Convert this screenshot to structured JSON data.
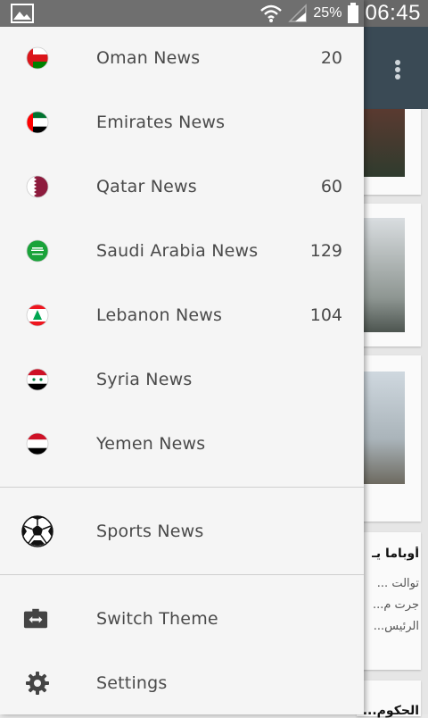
{
  "status_bar": {
    "battery_percent": "25%",
    "time": "06:45",
    "icons": [
      "image-icon",
      "wifi-icon",
      "signal-icon",
      "battery-icon"
    ]
  },
  "drawer": {
    "countries": [
      {
        "label": "Oman News",
        "count": "20",
        "flag": "oman-flag-icon"
      },
      {
        "label": "Emirates News",
        "count": "",
        "flag": "uae-flag-icon"
      },
      {
        "label": "Qatar News",
        "count": "60",
        "flag": "qatar-flag-icon"
      },
      {
        "label": "Saudi Arabia News",
        "count": "129",
        "flag": "saudi-flag-icon"
      },
      {
        "label": "Lebanon News",
        "count": "104",
        "flag": "lebanon-flag-icon"
      },
      {
        "label": "Syria News",
        "count": "",
        "flag": "syria-flag-icon"
      },
      {
        "label": "Yemen News",
        "count": "",
        "flag": "yemen-flag-icon"
      }
    ],
    "sports": {
      "label": "Sports News",
      "icon": "soccer-ball-icon"
    },
    "switch_theme": {
      "label": "Switch Theme",
      "icon": "switch-theme-icon"
    },
    "settings": {
      "label": "Settings",
      "icon": "gear-icon"
    }
  },
  "background": {
    "article_title": "أوباما يـ",
    "article_lines": [
      "توالت ...",
      "جرت م...",
      "الرئيس..."
    ],
    "article_title_2": "الحكوم..."
  }
}
